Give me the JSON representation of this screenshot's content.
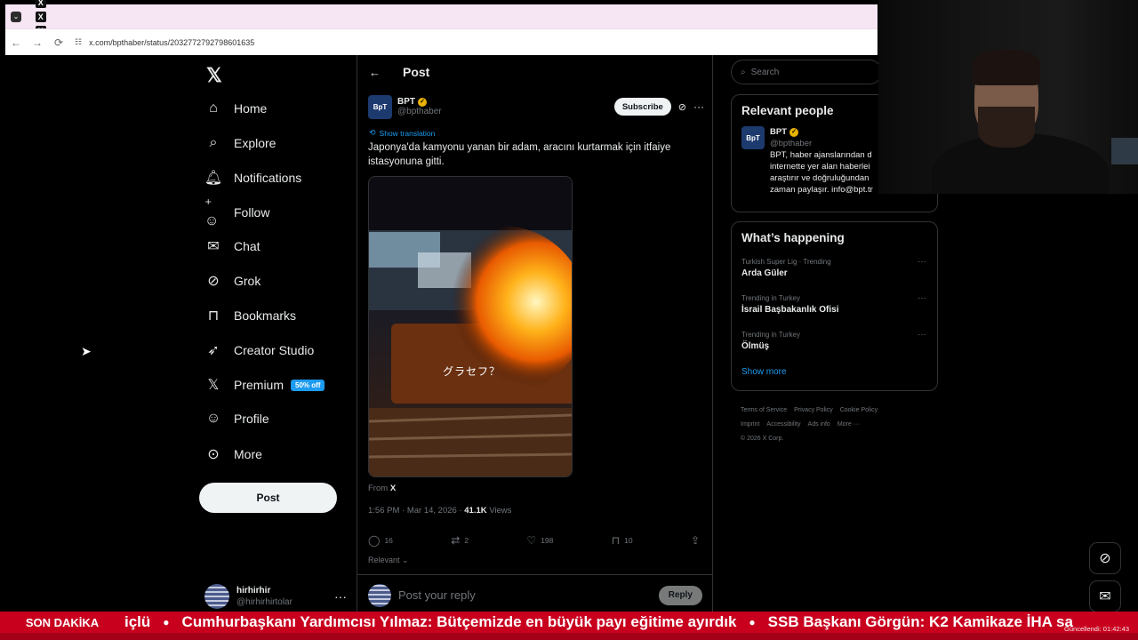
{
  "browser": {
    "url": "x.com/bpthaber/status/2032772792798601635",
    "tab_count": 39
  },
  "nav": {
    "items": [
      {
        "label": "Home",
        "icon": "home-icon"
      },
      {
        "label": "Explore",
        "icon": "search-icon"
      },
      {
        "label": "Notifications",
        "icon": "bell-icon"
      },
      {
        "label": "Follow",
        "icon": "add-person-icon"
      },
      {
        "label": "Chat",
        "icon": "mail-icon"
      },
      {
        "label": "Grok",
        "icon": "grok-icon"
      },
      {
        "label": "Bookmarks",
        "icon": "bookmark-icon"
      },
      {
        "label": "Creator Studio",
        "icon": "rocket-icon"
      },
      {
        "label": "Premium",
        "icon": "x-icon"
      },
      {
        "label": "Profile",
        "icon": "person-icon"
      },
      {
        "label": "More",
        "icon": "more-circle-icon"
      }
    ],
    "premium_badge": "50% off",
    "post_button": "Post",
    "account": {
      "name": "hirhirhir",
      "handle": "@hirhirhirtolar"
    }
  },
  "post": {
    "header_title": "Post",
    "author_name": "BPT",
    "author_handle": "@bpthaber",
    "avatar_text": "BpT",
    "subscribe_label": "Subscribe",
    "show_translation": "Show translation",
    "text": "Japonya'da kamyonu yanan bir adam, aracını kurtarmak için itfaiye istasyonuna gitti.",
    "video_caption": "グラセフ？",
    "from_label": "From",
    "from_source": "X",
    "time": "1:56 PM · Mar 14, 2026 · ",
    "views_count": "41.1K",
    "views_label": " Views",
    "replies": "16",
    "reposts": "2",
    "likes": "198",
    "bookmarks": "10",
    "relevant_label": "Relevant",
    "reply_placeholder": "Post your reply",
    "reply_button": "Reply"
  },
  "sidebar": {
    "search_placeholder": "Search",
    "relevant_title": "Relevant people",
    "relevant_person": {
      "name": "BPT",
      "handle": "@bpthaber",
      "bio": "BPT, haber ajanslarından d internette yer alan haberlei araştırır ve doğruluğundan zaman paylaşır. info@bpt.tr"
    },
    "happening_title": "What’s happening",
    "trends": [
      {
        "meta": "Turkish Super Lig · Trending",
        "name": "Arda Güler"
      },
      {
        "meta": "Trending in Turkey",
        "name": "İsrail Başbakanlık Ofisi"
      },
      {
        "meta": "Trending in Turkey",
        "name": "Ölmüş"
      }
    ],
    "show_more": "Show more",
    "footer_links": [
      "Terms of Service",
      "Privacy Policy",
      "Cookie Policy",
      "Imprint",
      "Accessibility",
      "Ads info",
      "More ···"
    ],
    "copyright": "© 2026 X Corp."
  },
  "ticker": {
    "label": "SON DAKİKA",
    "items": [
      "içlü",
      "Cumhurbaşkanı Yardımcısı Yılmaz: Bütçemizde en büyük payı eğitime ayırdık",
      "SSB Başkanı Görgün: K2 Kamikaze İHA sa"
    ],
    "updated": "Güncellendi: 01:42:43"
  },
  "colors": {
    "accent": "#1d9bf0",
    "verified": "#e8b300",
    "ticker": "#c8001e"
  }
}
